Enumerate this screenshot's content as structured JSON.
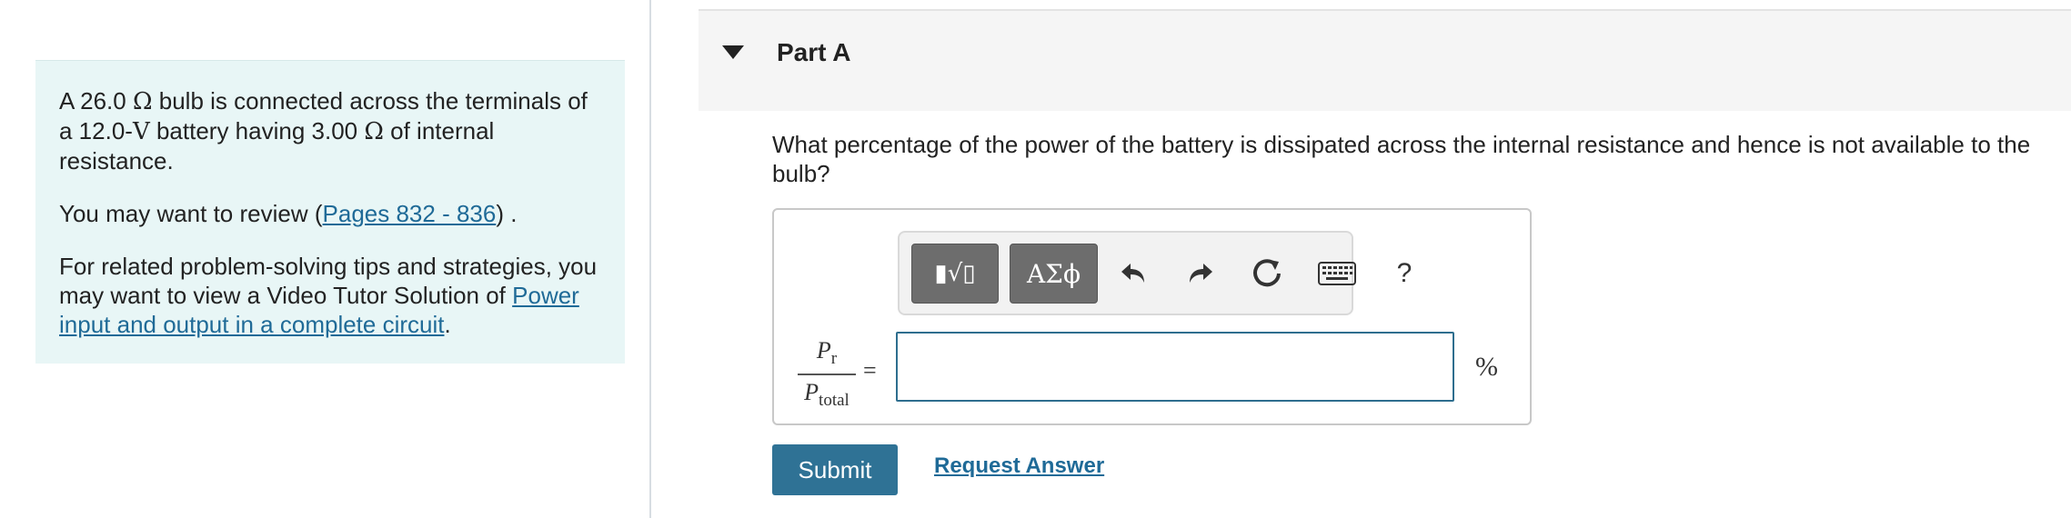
{
  "intro": {
    "p1_a": "A 26.0 ",
    "ohm": "Ω",
    "p1_b": " bulb is connected across the terminals of a 12.0-",
    "volt": "V",
    "p1_c": " battery having 3.00 ",
    "p1_d": " of internal resistance.",
    "review_prefix": "You may want to review (",
    "review_link": "Pages 832 - 836",
    "review_suffix": ") .",
    "tips_text": "For related problem-solving tips and strategies, you may want to view a Video Tutor Solution of ",
    "tips_link": "Power input and output in a complete circuit",
    "tips_suffix": "."
  },
  "part": {
    "title": "Part A"
  },
  "question": "What percentage of the power of the battery is dissipated across the internal resistance and hence is not available to the bulb?",
  "toolbar": {
    "templates_label": "▮√▯",
    "greek_label": "ΑΣϕ",
    "undo_icon": "undo-icon",
    "redo_icon": "redo-icon",
    "reset_icon": "reset-icon",
    "keyboard_icon": "keyboard-icon",
    "help_label": "?"
  },
  "formula": {
    "numerator": "P",
    "numerator_sub": "r",
    "denominator": "P",
    "denominator_sub": "total",
    "equals": "="
  },
  "answer": {
    "value": "",
    "unit": "%"
  },
  "actions": {
    "submit_label": "Submit",
    "request_label": "Request Answer"
  },
  "colors": {
    "panel_bg": "#e8f6f6",
    "link": "#1f6a97",
    "submit_bg": "#2f7295",
    "input_border": "#2e6e8e"
  }
}
